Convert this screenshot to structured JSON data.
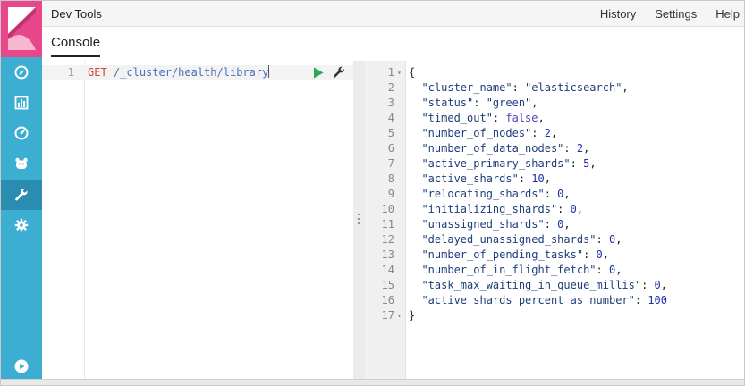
{
  "app": {
    "title": "Dev Tools"
  },
  "top_nav": {
    "history": "History",
    "settings": "Settings",
    "help": "Help"
  },
  "tabs": [
    {
      "label": "Console"
    }
  ],
  "sidebar": {
    "items": [
      {
        "icon": "compass-icon"
      },
      {
        "icon": "bar-chart-icon"
      },
      {
        "icon": "gauge-icon"
      },
      {
        "icon": "bear-icon"
      },
      {
        "icon": "wrench-icon",
        "active": true
      },
      {
        "icon": "gear-icon"
      }
    ],
    "bottom_icon": "play-circle-icon"
  },
  "request": {
    "line_number": "1",
    "method": "GET",
    "path": "/_cluster/health/library"
  },
  "response": {
    "lines": [
      {
        "n": "1",
        "fold": "▾",
        "tokens": [
          {
            "t": "{",
            "c": "p"
          }
        ]
      },
      {
        "n": "2",
        "tokens": [
          {
            "t": "  \"cluster_name\"",
            "c": "key"
          },
          {
            "t": ": ",
            "c": "p"
          },
          {
            "t": "\"elasticsearch\"",
            "c": "str"
          },
          {
            "t": ",",
            "c": "p"
          }
        ]
      },
      {
        "n": "3",
        "tokens": [
          {
            "t": "  \"status\"",
            "c": "key"
          },
          {
            "t": ": ",
            "c": "p"
          },
          {
            "t": "\"green\"",
            "c": "str"
          },
          {
            "t": ",",
            "c": "p"
          }
        ]
      },
      {
        "n": "4",
        "tokens": [
          {
            "t": "  \"timed_out\"",
            "c": "key"
          },
          {
            "t": ": ",
            "c": "p"
          },
          {
            "t": "false",
            "c": "bool"
          },
          {
            "t": ",",
            "c": "p"
          }
        ]
      },
      {
        "n": "5",
        "tokens": [
          {
            "t": "  \"number_of_nodes\"",
            "c": "key"
          },
          {
            "t": ": ",
            "c": "p"
          },
          {
            "t": "2",
            "c": "num"
          },
          {
            "t": ",",
            "c": "p"
          }
        ]
      },
      {
        "n": "6",
        "tokens": [
          {
            "t": "  \"number_of_data_nodes\"",
            "c": "key"
          },
          {
            "t": ": ",
            "c": "p"
          },
          {
            "t": "2",
            "c": "num"
          },
          {
            "t": ",",
            "c": "p"
          }
        ]
      },
      {
        "n": "7",
        "tokens": [
          {
            "t": "  \"active_primary_shards\"",
            "c": "key"
          },
          {
            "t": ": ",
            "c": "p"
          },
          {
            "t": "5",
            "c": "num"
          },
          {
            "t": ",",
            "c": "p"
          }
        ]
      },
      {
        "n": "8",
        "tokens": [
          {
            "t": "  \"active_shards\"",
            "c": "key"
          },
          {
            "t": ": ",
            "c": "p"
          },
          {
            "t": "10",
            "c": "num"
          },
          {
            "t": ",",
            "c": "p"
          }
        ]
      },
      {
        "n": "9",
        "tokens": [
          {
            "t": "  \"relocating_shards\"",
            "c": "key"
          },
          {
            "t": ": ",
            "c": "p"
          },
          {
            "t": "0",
            "c": "num"
          },
          {
            "t": ",",
            "c": "p"
          }
        ]
      },
      {
        "n": "10",
        "tokens": [
          {
            "t": "  \"initializing_shards\"",
            "c": "key"
          },
          {
            "t": ": ",
            "c": "p"
          },
          {
            "t": "0",
            "c": "num"
          },
          {
            "t": ",",
            "c": "p"
          }
        ]
      },
      {
        "n": "11",
        "tokens": [
          {
            "t": "  \"unassigned_shards\"",
            "c": "key"
          },
          {
            "t": ": ",
            "c": "p"
          },
          {
            "t": "0",
            "c": "num"
          },
          {
            "t": ",",
            "c": "p"
          }
        ]
      },
      {
        "n": "12",
        "tokens": [
          {
            "t": "  \"delayed_unassigned_shards\"",
            "c": "key"
          },
          {
            "t": ": ",
            "c": "p"
          },
          {
            "t": "0",
            "c": "num"
          },
          {
            "t": ",",
            "c": "p"
          }
        ]
      },
      {
        "n": "13",
        "tokens": [
          {
            "t": "  \"number_of_pending_tasks\"",
            "c": "key"
          },
          {
            "t": ": ",
            "c": "p"
          },
          {
            "t": "0",
            "c": "num"
          },
          {
            "t": ",",
            "c": "p"
          }
        ]
      },
      {
        "n": "14",
        "tokens": [
          {
            "t": "  \"number_of_in_flight_fetch\"",
            "c": "key"
          },
          {
            "t": ": ",
            "c": "p"
          },
          {
            "t": "0",
            "c": "num"
          },
          {
            "t": ",",
            "c": "p"
          }
        ]
      },
      {
        "n": "15",
        "tokens": [
          {
            "t": "  \"task_max_waiting_in_queue_millis\"",
            "c": "key"
          },
          {
            "t": ": ",
            "c": "p"
          },
          {
            "t": "0",
            "c": "num"
          },
          {
            "t": ",",
            "c": "p"
          }
        ]
      },
      {
        "n": "16",
        "tokens": [
          {
            "t": "  \"active_shards_percent_as_number\"",
            "c": "key"
          },
          {
            "t": ": ",
            "c": "p"
          },
          {
            "t": "100",
            "c": "num"
          }
        ]
      },
      {
        "n": "17",
        "fold": "▾",
        "tokens": [
          {
            "t": "}",
            "c": "p"
          }
        ]
      }
    ]
  },
  "colors": {
    "sidebar": "#3caed2",
    "sidebar_active": "#2a8cb0",
    "logo": "#e8488b",
    "method": "#c9473b",
    "path": "#4a70b8",
    "play": "#2fa84f"
  }
}
